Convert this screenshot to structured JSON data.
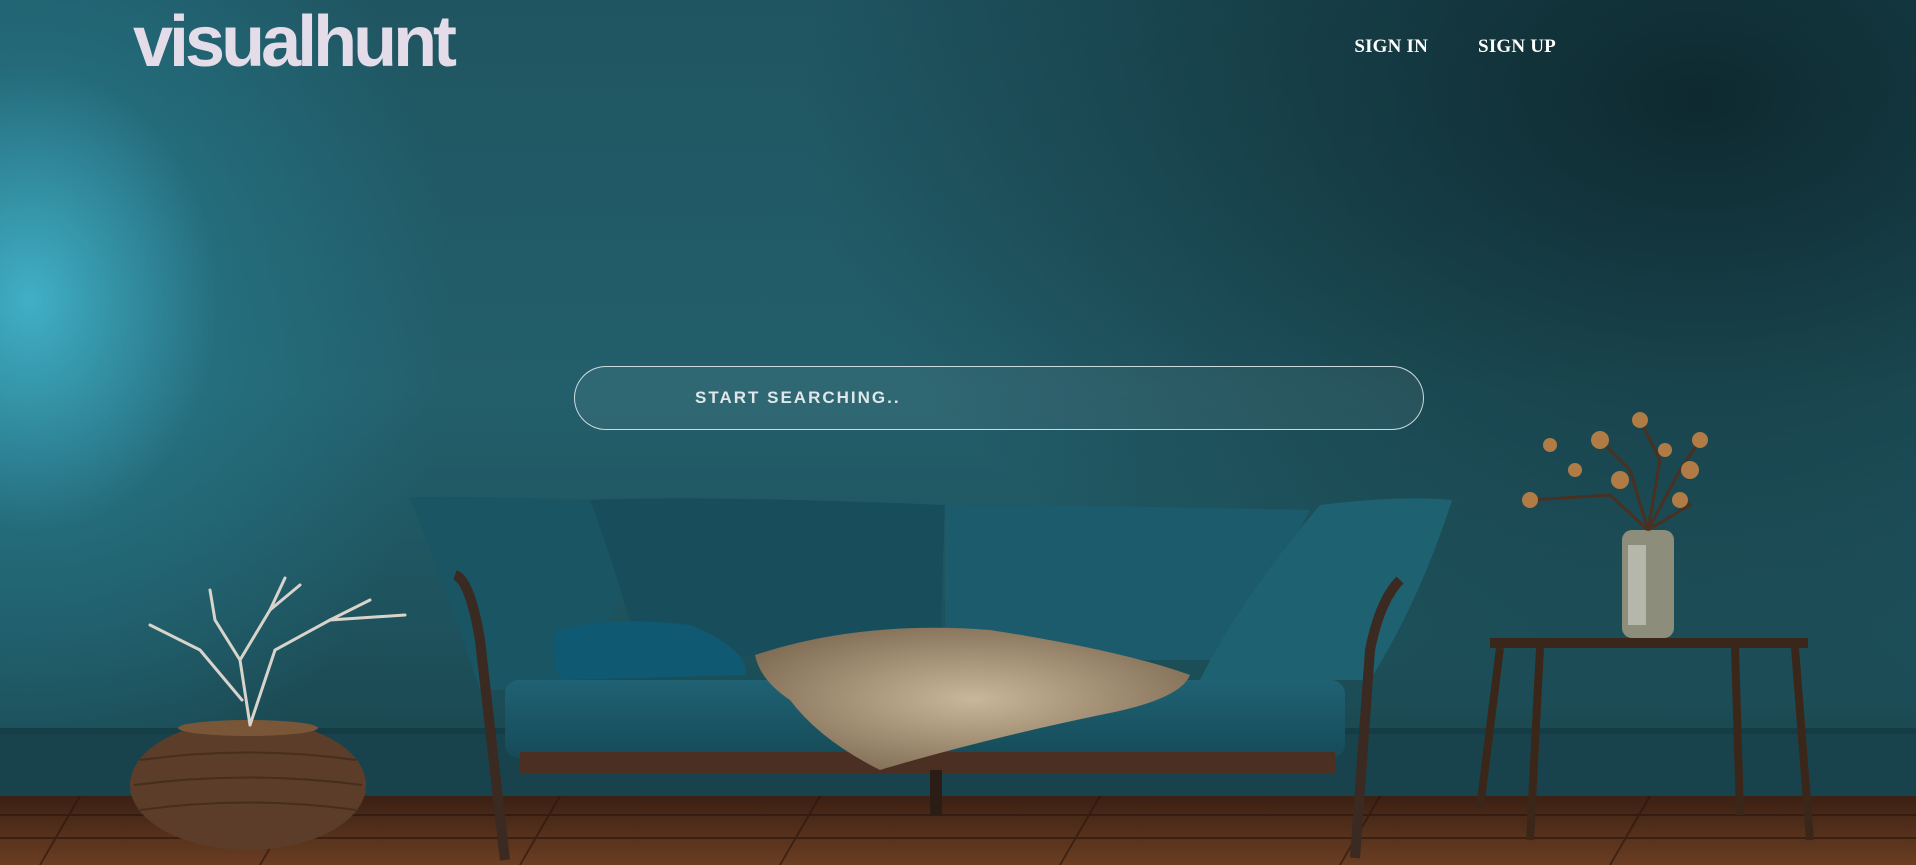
{
  "brand": {
    "logo_text": "visualhunt"
  },
  "nav": {
    "sign_in_label": "SIGN IN",
    "sign_up_label": "SIGN UP"
  },
  "search": {
    "placeholder": "START SEARCHING..",
    "value": ""
  },
  "colors": {
    "wall": "#235f6b",
    "sofa": "#1a5664",
    "floor": "#5a3521",
    "text": "#ffffff",
    "logo": "#e4dde9"
  }
}
